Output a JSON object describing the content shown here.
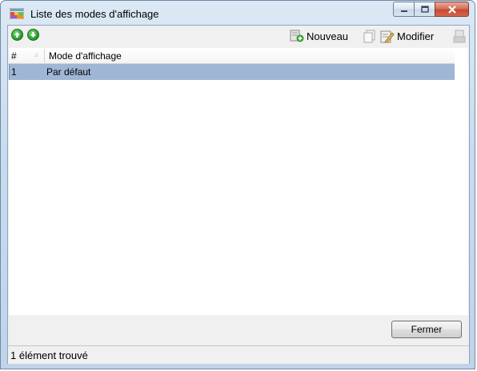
{
  "window": {
    "title": "Liste des modes d'affichage"
  },
  "toolbar": {
    "nouveau_label": "Nouveau",
    "modifier_label": "Modifier"
  },
  "grid": {
    "columns": [
      "#",
      "Mode d'affichage"
    ],
    "rows": [
      {
        "num": "1",
        "mode": "Par défaut"
      }
    ]
  },
  "footer": {
    "close_label": "Fermer"
  },
  "status": {
    "text": "1 élément trouvé"
  },
  "colors": {
    "selected_row": "#9fb6d4",
    "move_button": "#2e9e2e"
  },
  "icons": [
    "app-icon",
    "arrow-up-icon",
    "arrow-down-icon",
    "new-icon",
    "copy-icon",
    "edit-icon",
    "delete-icon",
    "minimize-icon",
    "maximize-icon",
    "close-icon"
  ]
}
